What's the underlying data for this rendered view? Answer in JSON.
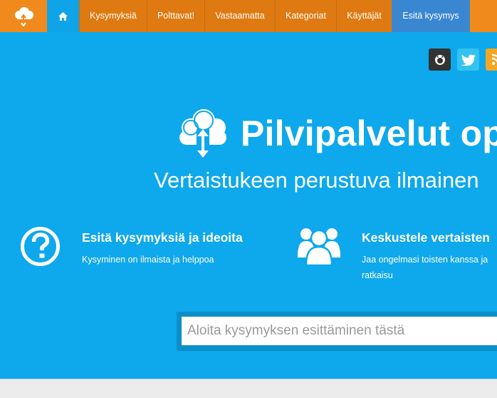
{
  "nav": {
    "home_icon": "home-icon",
    "logo_icon": "cloud-logo-icon",
    "items": [
      {
        "label": "Kysymyksiä",
        "width": 82
      },
      {
        "label": "Polttavat!",
        "width": 81
      },
      {
        "label": "Vastaamatta",
        "width": 99
      },
      {
        "label": "Kategoriat",
        "width": 86
      },
      {
        "label": "Käyttäjät",
        "width": 79
      }
    ],
    "ask_label": "Esitä kysymys"
  },
  "social": [
    {
      "name": "github-icon",
      "color": "#333333"
    },
    {
      "name": "twitter-icon",
      "color": "#34c3ef"
    },
    {
      "name": "rss-icon",
      "color": "#f5a623"
    }
  ],
  "hero": {
    "title": "Pilvipalvelut op",
    "subtitle": "Vertaistukeen perustuva ilmainen"
  },
  "features": [
    {
      "icon": "question-icon",
      "title": "Esitä kysymyksiä ja ideoita",
      "desc": "Kysyminen on ilmaista ja helppoa"
    },
    {
      "icon": "users-icon",
      "title": "Keskustele vertaisten",
      "desc": "Jaa ongelmasi toisten kanssa ja ratkaisu"
    }
  ],
  "search": {
    "placeholder": "Aloita kysymyksen esittäminen tästä"
  },
  "colors": {
    "nav": "#f08a1c",
    "nav_item": "#df7a12",
    "home_active": "#0fa4e8",
    "ask_button": "#3a87d1",
    "hero": "#0ea8ec"
  }
}
